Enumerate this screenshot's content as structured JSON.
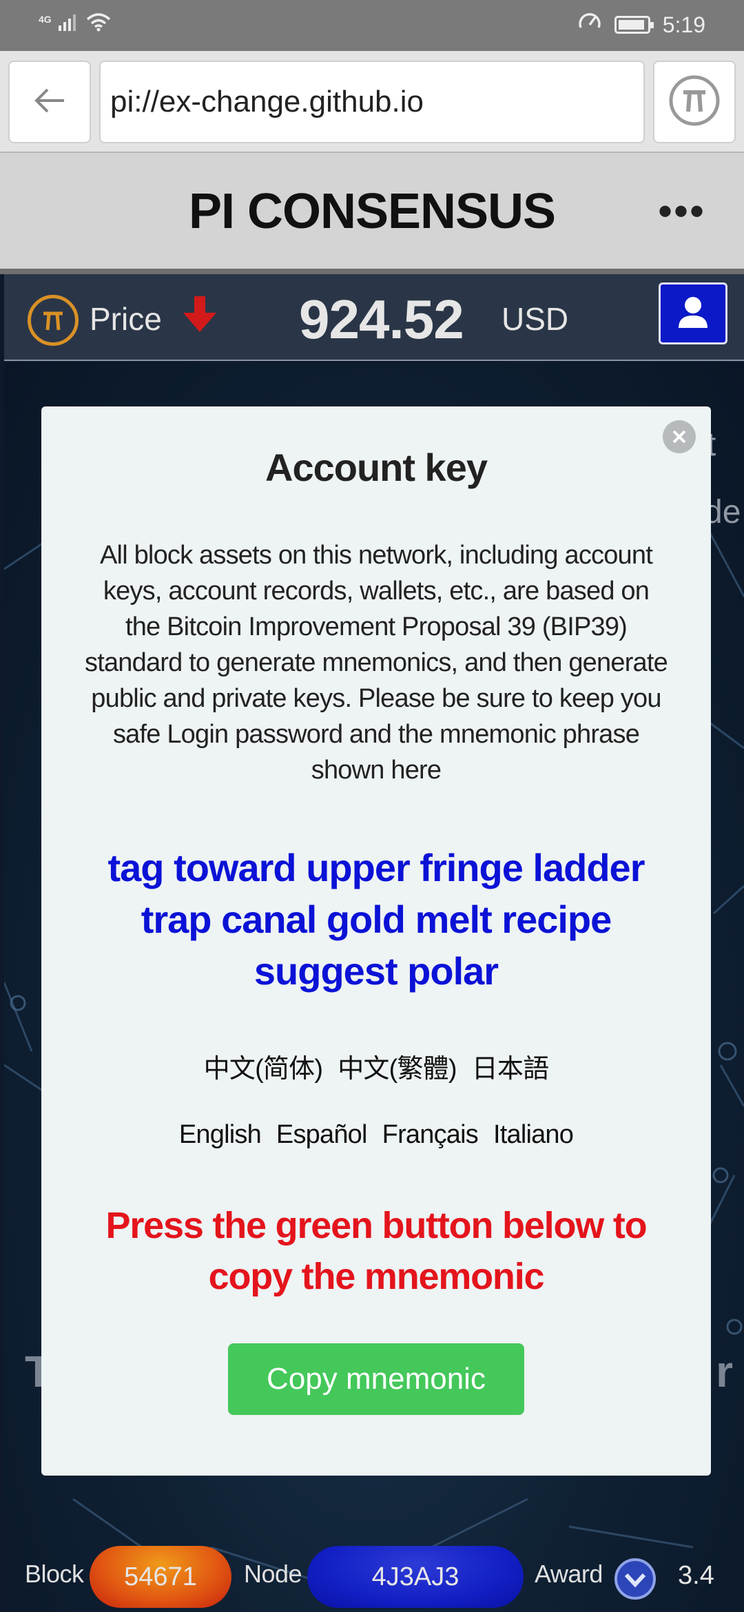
{
  "status_bar": {
    "network": "4G",
    "time": "5:19"
  },
  "browser": {
    "url": "pi://ex-change.github.io"
  },
  "header": {
    "title": "PI CONSENSUS",
    "more_label": "•••"
  },
  "price_bar": {
    "label": "Price",
    "value": "924.52",
    "unit": "USD"
  },
  "background": {
    "ghost_line_1": "t",
    "ghost_line_2": "de",
    "ghost_left": "T",
    "ghost_right": "r"
  },
  "modal": {
    "title": "Account key",
    "description": "All block assets on this network, including account keys, account records, wallets, etc., are based on the Bitcoin Improvement Proposal 39 (BIP39) standard to generate mnemonics, and then generate public and private keys. Please be sure to keep you safe Login password and the mnemonic phrase shown here",
    "mnemonic": "tag toward upper fringe ladder trap canal gold melt recipe suggest polar",
    "languages_row1": [
      "中文(简体)",
      "中文(繁體)",
      "日本語"
    ],
    "languages_row2": [
      "English",
      "Español",
      "Français",
      "Italiano"
    ],
    "warning": "Press the green button below to copy the mnemonic",
    "copy_button": "Copy mnemonic"
  },
  "bottom_bar": {
    "block_label": "Block",
    "block_value": "54671",
    "node_label": "Node",
    "node_value": "4J3AJ3",
    "award_label": "Award",
    "award_value": "3.4"
  },
  "colors": {
    "mnemonic": "#0b12d6",
    "warning": "#e4141c",
    "copy_button": "#44c85a",
    "user_button": "#0c19c8",
    "block_pill": "#e25a12",
    "node_pill": "#121fc4",
    "price_down": "#d21a1a",
    "pi_coin": "#d99126"
  }
}
